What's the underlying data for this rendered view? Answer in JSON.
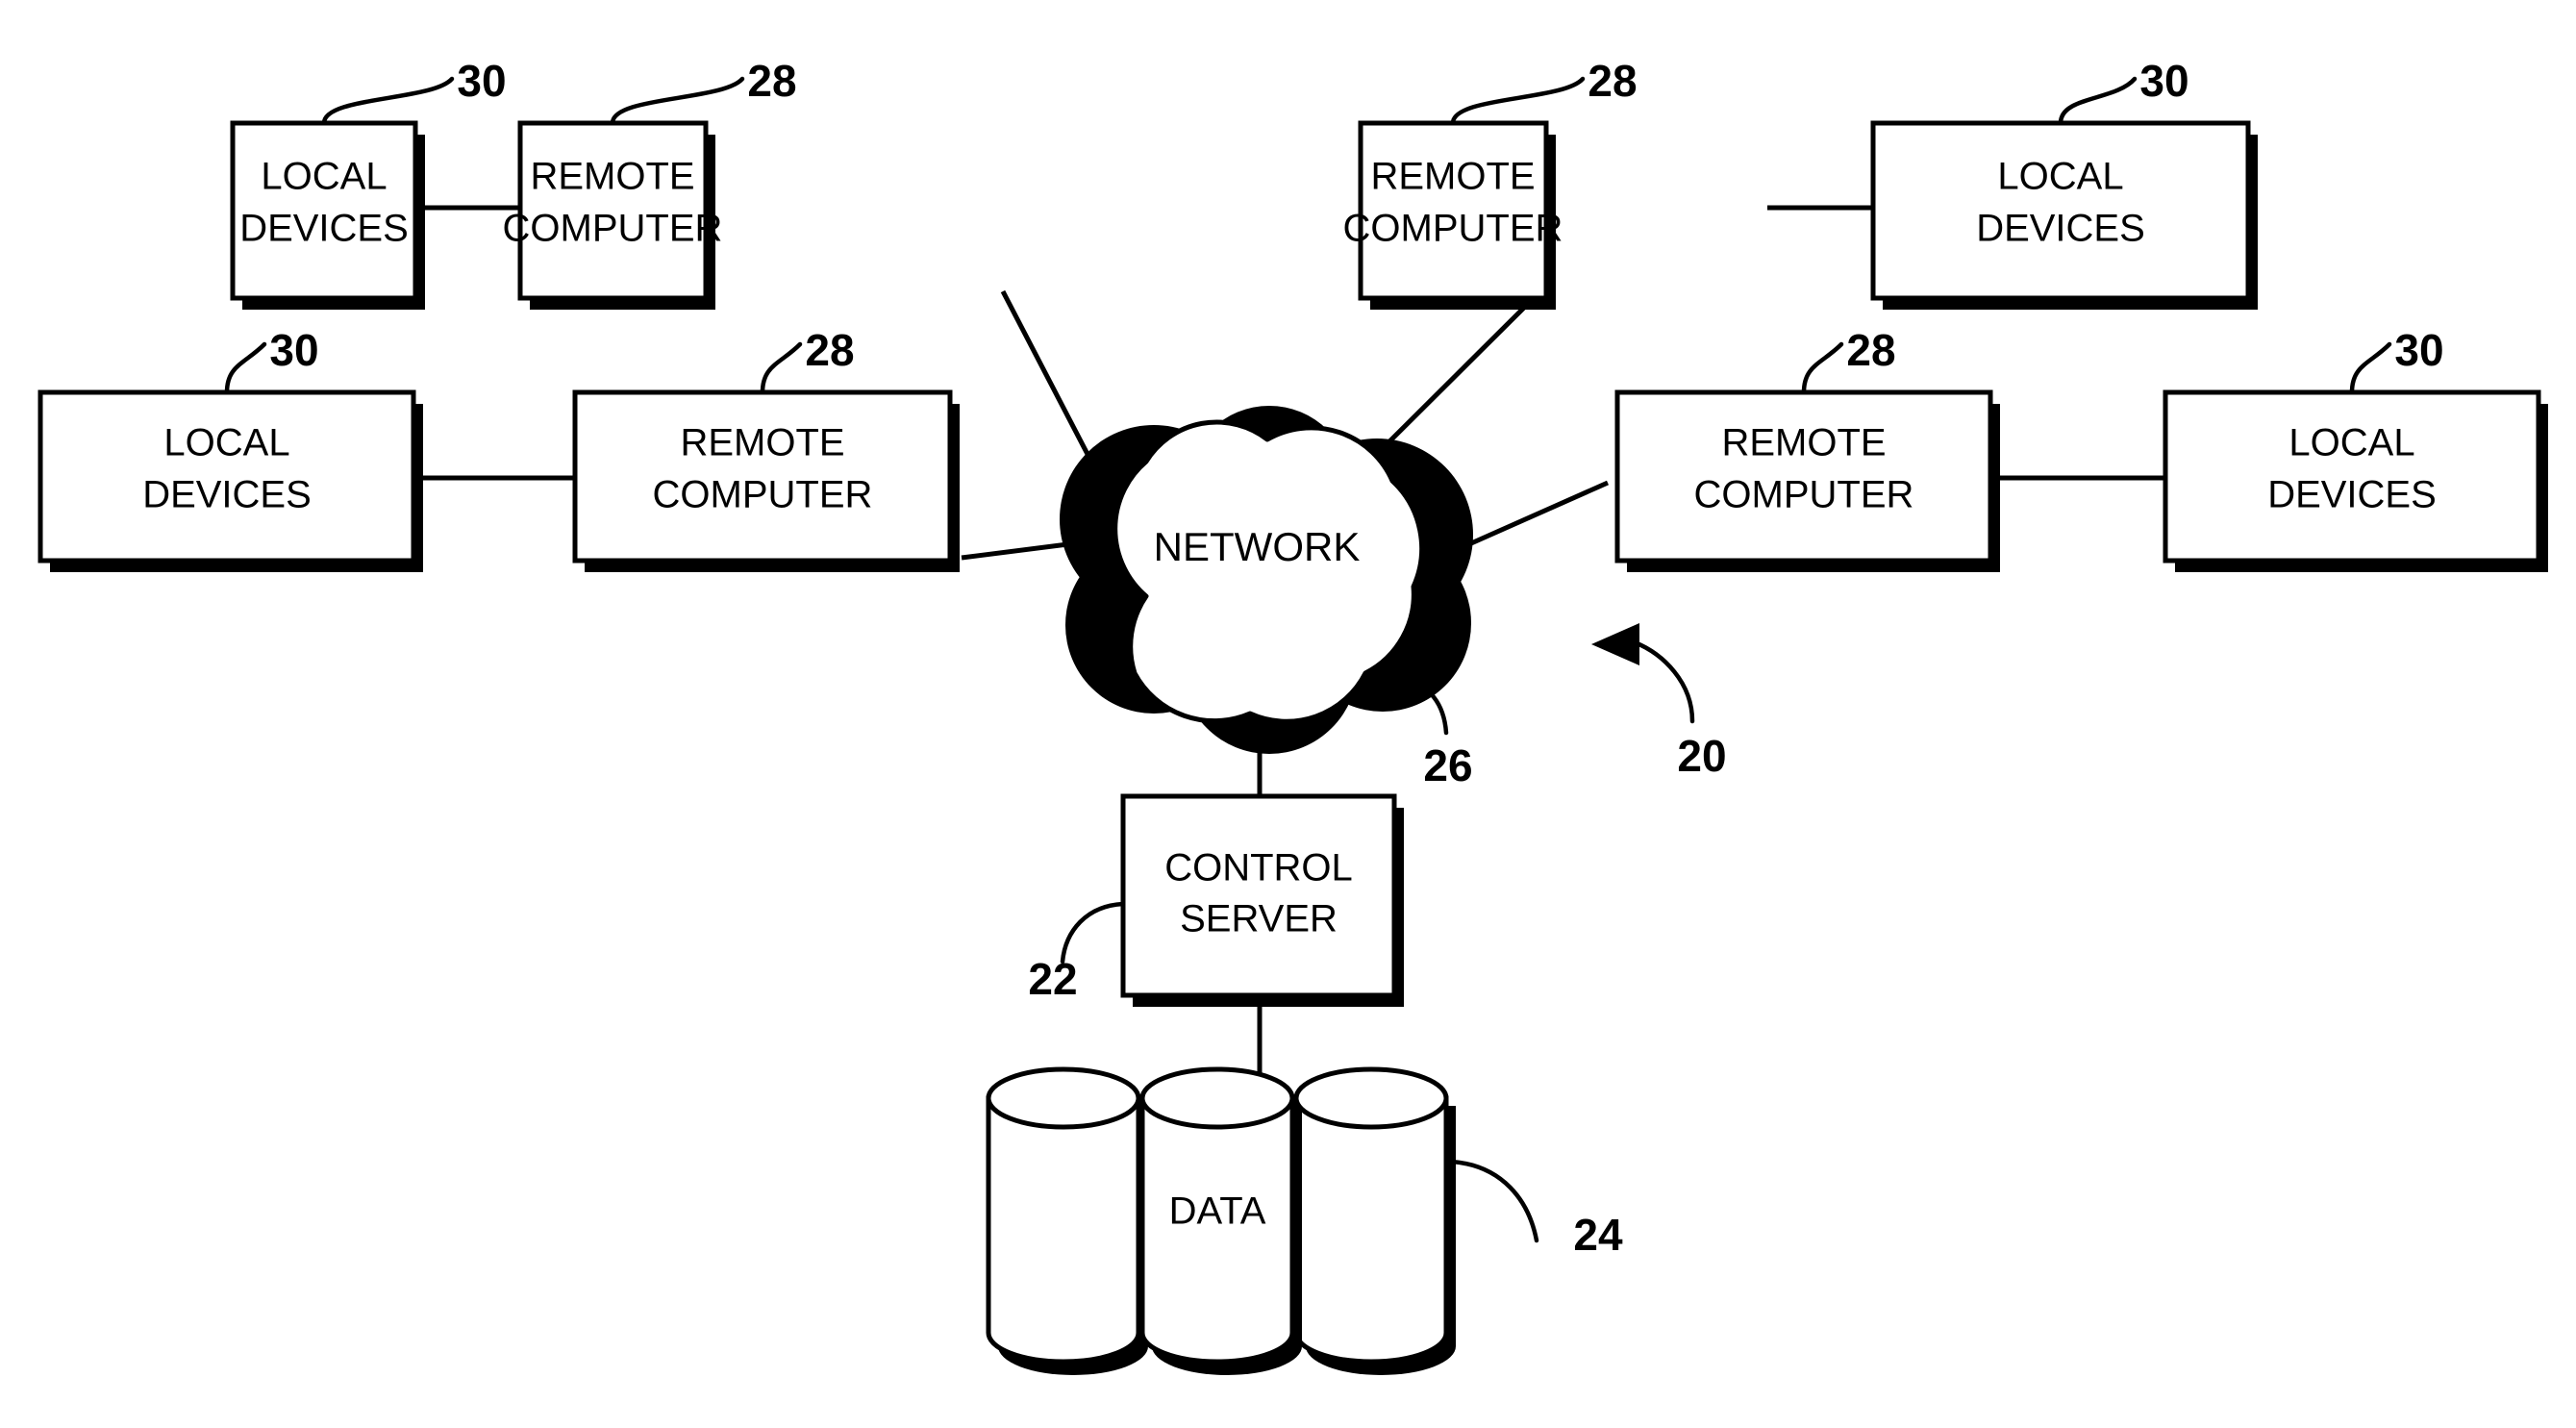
{
  "figure": {
    "title": "Network system block diagram",
    "background_color": "#ffffff",
    "line_color": "#000000"
  },
  "nodes": {
    "top_left_local": {
      "line1": "LOCAL",
      "line2": "DEVICES"
    },
    "top_left_remote": {
      "line1": "REMOTE",
      "line2": "COMPUTER"
    },
    "top_right_remote": {
      "line1": "REMOTE",
      "line2": "COMPUTER"
    },
    "top_right_local": {
      "line1": "LOCAL",
      "line2": "DEVICES"
    },
    "mid_left_local": {
      "line1": "LOCAL",
      "line2": "DEVICES"
    },
    "mid_left_remote": {
      "line1": "REMOTE",
      "line2": "COMPUTER"
    },
    "mid_right_remote": {
      "line1": "REMOTE",
      "line2": "COMPUTER"
    },
    "mid_right_local": {
      "line1": "LOCAL",
      "line2": "DEVICES"
    },
    "control_server": {
      "line1": "CONTROL",
      "line2": "SERVER"
    },
    "network_cloud": {
      "label": "NETWORK"
    },
    "data_store": {
      "label": "DATA"
    }
  },
  "reference_numerals": {
    "system": "20",
    "control_server": "22",
    "data_store": "24",
    "network": "26",
    "remote_computer": "28",
    "local_devices": "30",
    "top_left_local": "30",
    "top_left_remote": "28",
    "top_right_remote": "28",
    "top_right_local": "30",
    "mid_left_local": "30",
    "mid_left_remote": "28",
    "mid_right_remote": "28",
    "mid_right_local": "30"
  }
}
